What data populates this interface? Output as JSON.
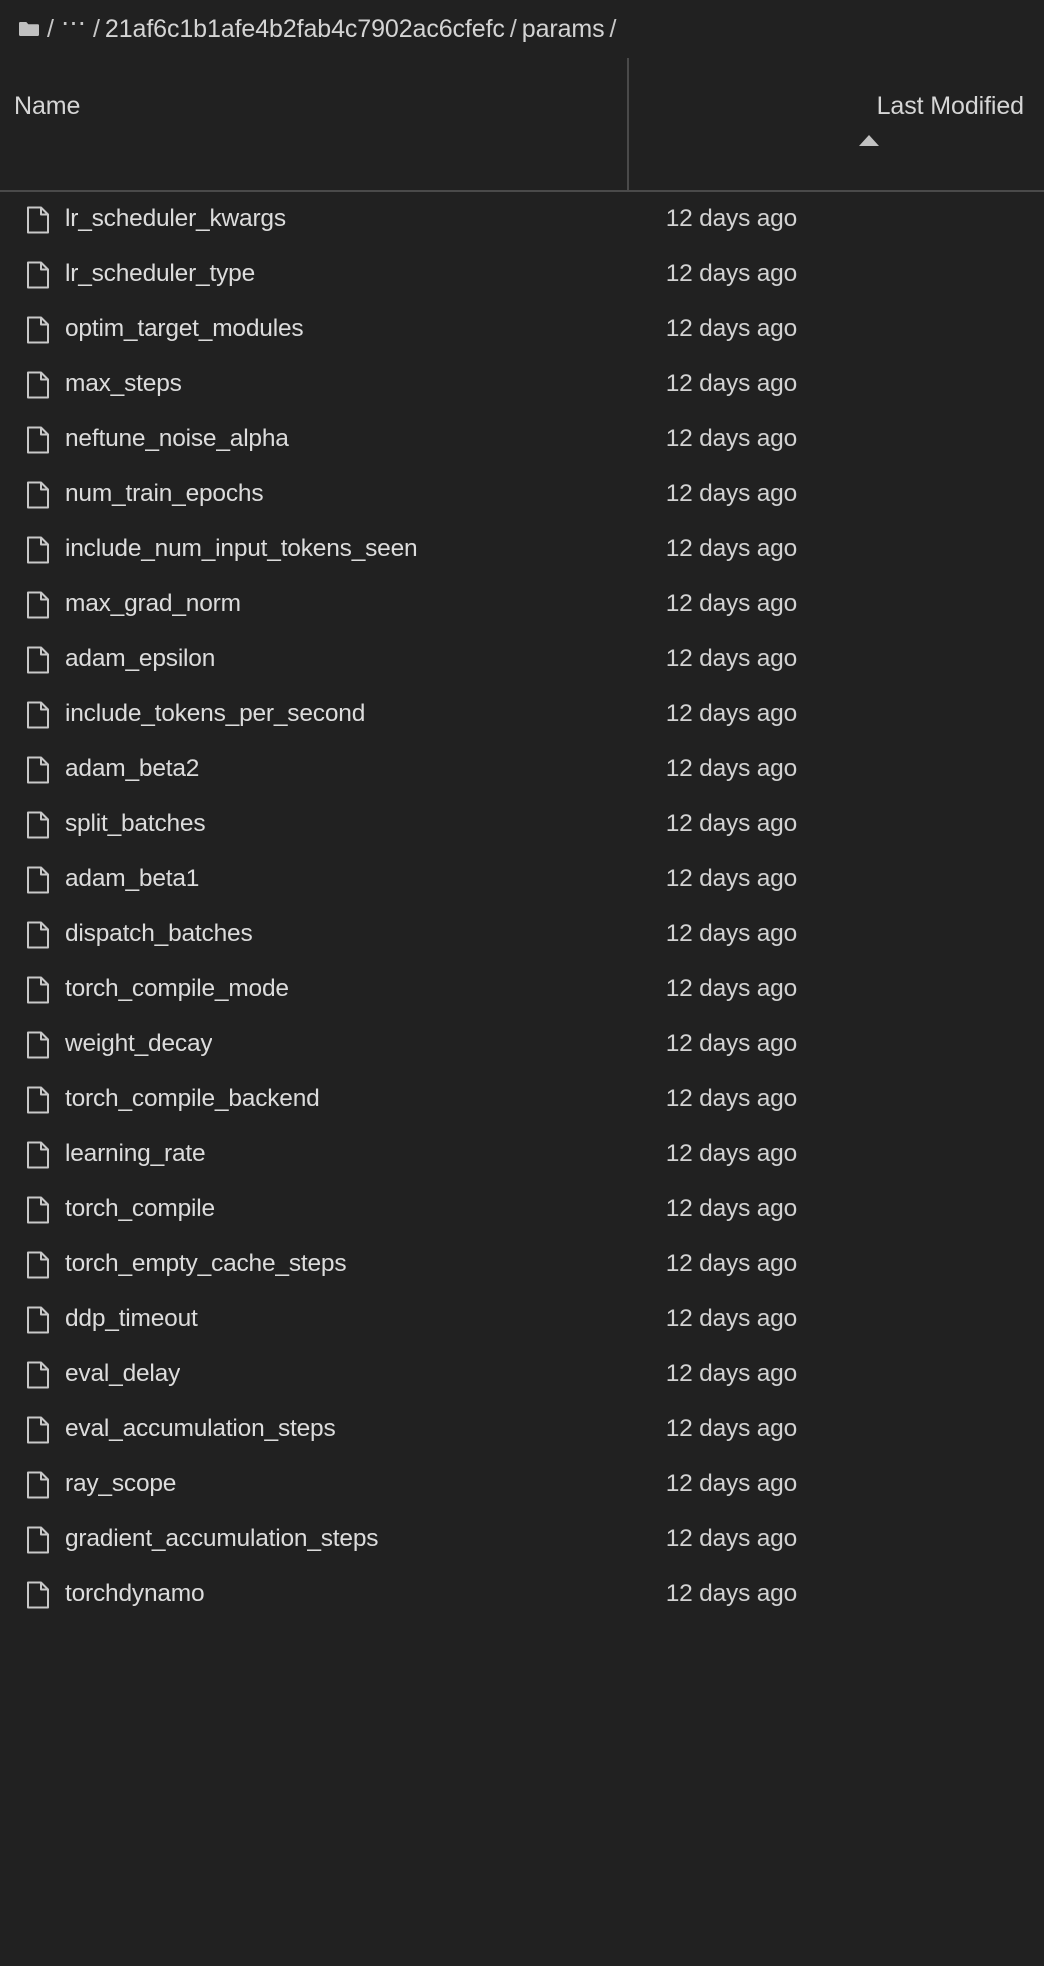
{
  "breadcrumb": {
    "folder_icon": "folder-icon",
    "separator": "/",
    "ellipsis": "⋯",
    "items": [
      {
        "label": "21af6c1b1afe4b2fab4c7902ac6cfefc"
      },
      {
        "label": "params"
      }
    ]
  },
  "table": {
    "columns": [
      {
        "key": "name",
        "label": "Name",
        "sorted": false
      },
      {
        "key": "last_modified",
        "label": "Last Modified",
        "sorted": true,
        "sort_direction": "ascending",
        "sort_icon": "caret-up-icon"
      }
    ],
    "rows": [
      {
        "icon": "file-icon",
        "name": "lr_scheduler_kwargs",
        "last_modified": "12 days ago"
      },
      {
        "icon": "file-icon",
        "name": "lr_scheduler_type",
        "last_modified": "12 days ago"
      },
      {
        "icon": "file-icon",
        "name": "optim_target_modules",
        "last_modified": "12 days ago"
      },
      {
        "icon": "file-icon",
        "name": "max_steps",
        "last_modified": "12 days ago"
      },
      {
        "icon": "file-icon",
        "name": "neftune_noise_alpha",
        "last_modified": "12 days ago"
      },
      {
        "icon": "file-icon",
        "name": "num_train_epochs",
        "last_modified": "12 days ago"
      },
      {
        "icon": "file-icon",
        "name": "include_num_input_tokens_seen",
        "last_modified": "12 days ago"
      },
      {
        "icon": "file-icon",
        "name": "max_grad_norm",
        "last_modified": "12 days ago"
      },
      {
        "icon": "file-icon",
        "name": "adam_epsilon",
        "last_modified": "12 days ago"
      },
      {
        "icon": "file-icon",
        "name": "include_tokens_per_second",
        "last_modified": "12 days ago"
      },
      {
        "icon": "file-icon",
        "name": "adam_beta2",
        "last_modified": "12 days ago"
      },
      {
        "icon": "file-icon",
        "name": "split_batches",
        "last_modified": "12 days ago"
      },
      {
        "icon": "file-icon",
        "name": "adam_beta1",
        "last_modified": "12 days ago"
      },
      {
        "icon": "file-icon",
        "name": "dispatch_batches",
        "last_modified": "12 days ago"
      },
      {
        "icon": "file-icon",
        "name": "torch_compile_mode",
        "last_modified": "12 days ago"
      },
      {
        "icon": "file-icon",
        "name": "weight_decay",
        "last_modified": "12 days ago"
      },
      {
        "icon": "file-icon",
        "name": "torch_compile_backend",
        "last_modified": "12 days ago"
      },
      {
        "icon": "file-icon",
        "name": "learning_rate",
        "last_modified": "12 days ago"
      },
      {
        "icon": "file-icon",
        "name": "torch_compile",
        "last_modified": "12 days ago"
      },
      {
        "icon": "file-icon",
        "name": "torch_empty_cache_steps",
        "last_modified": "12 days ago"
      },
      {
        "icon": "file-icon",
        "name": "ddp_timeout",
        "last_modified": "12 days ago"
      },
      {
        "icon": "file-icon",
        "name": "eval_delay",
        "last_modified": "12 days ago"
      },
      {
        "icon": "file-icon",
        "name": "eval_accumulation_steps",
        "last_modified": "12 days ago"
      },
      {
        "icon": "file-icon",
        "name": "ray_scope",
        "last_modified": "12 days ago"
      },
      {
        "icon": "file-icon",
        "name": "gradient_accumulation_steps",
        "last_modified": "12 days ago"
      },
      {
        "icon": "file-icon",
        "name": "torchdynamo",
        "last_modified": "12 days ago"
      }
    ]
  },
  "colors": {
    "background": "#212121",
    "text": "#dcdcdc",
    "muted_text": "#c7c7c7",
    "divider": "#4a4a4a",
    "icon_stroke": "#c8c8c8"
  }
}
